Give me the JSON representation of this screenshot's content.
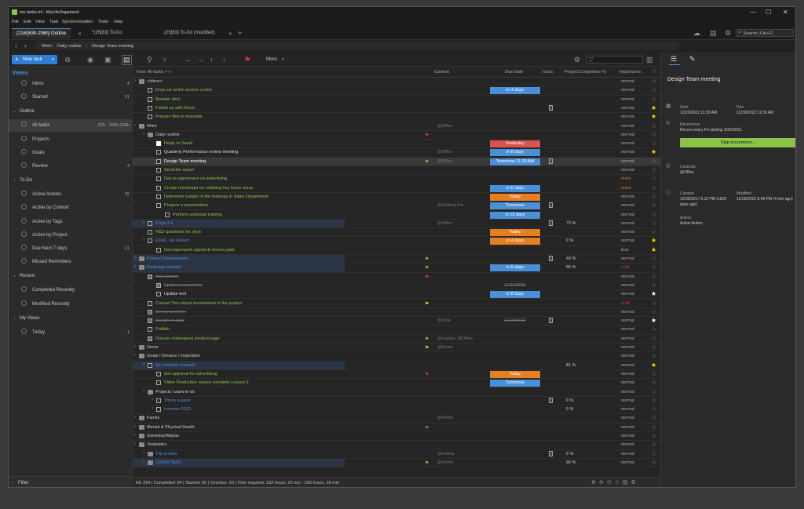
{
  "window": {
    "title": "my tasks.ml - MyLifeOrganized",
    "controls": [
      "—",
      "☐",
      "✕"
    ]
  },
  "menu": [
    "File",
    "Edit",
    "View",
    "Task",
    "Synchronization",
    "Tools",
    "Help"
  ],
  "tabs": [
    {
      "label": "(216/[63h-206h] Outline",
      "active": true
    },
    {
      "label": "*(25[63] To-Do",
      "active": false
    },
    {
      "label": "(25[63] To-Do (modified)",
      "active": false
    }
  ],
  "search": {
    "placeholder": "Search (Ctrl+F)"
  },
  "breadcrumb": [
    "Work",
    "Daily routine",
    "Design Team meeting"
  ],
  "toolbar": {
    "new_task": "New task",
    "more": "More"
  },
  "sidebar": {
    "views_title": "Views",
    "top": [
      {
        "label": "Inbox",
        "count": "4"
      },
      {
        "label": "Starred",
        "count": "31"
      }
    ],
    "outline_title": "Outline",
    "outline": [
      {
        "label": "All tasks",
        "count": "225 · 163h-206h",
        "selected": true
      },
      {
        "label": "Projects",
        "count": ""
      },
      {
        "label": "Goals",
        "count": ""
      },
      {
        "label": "Review",
        "count": "4"
      }
    ],
    "todo_title": "To-Do",
    "todo": [
      {
        "label": "Active Actions",
        "count": "32"
      },
      {
        "label": "Active by Context",
        "count": ""
      },
      {
        "label": "Active by Tags",
        "count": ""
      },
      {
        "label": "Active by Project",
        "count": ""
      },
      {
        "label": "Due Next 7 days",
        "count": "21"
      },
      {
        "label": "Missed Reminders",
        "count": ""
      }
    ],
    "recent_title": "Recent",
    "recent": [
      {
        "label": "Completed Recently",
        "count": ""
      },
      {
        "label": "Modified Recently",
        "count": ""
      }
    ],
    "myviews_title": "My Views",
    "myviews": [
      {
        "label": "Today",
        "count": "1"
      }
    ],
    "filter": "Filter"
  },
  "grid": {
    "headers": {
      "name": "View: All tasks > >",
      "context": "Context",
      "due": "Due Date",
      "icons": "Icons",
      "pct": "Project Completion %",
      "imp": "Importance"
    },
    "rows": [
      {
        "indent": 0,
        "type": "folder",
        "text": "<Inbox>",
        "color": "#ccc"
      },
      {
        "indent": 1,
        "type": "cb",
        "text": "Drop car at the service centre",
        "color": "#8bc34a",
        "due": "in 4 days",
        "dc": "#4a90d9"
      },
      {
        "indent": 1,
        "type": "cb",
        "text": "Booster shot",
        "color": "#8bc34a"
      },
      {
        "indent": 1,
        "type": "cb",
        "text": "Follow up with Kevin",
        "color": "#8bc34a",
        "doc": true,
        "star": "on"
      },
      {
        "indent": 1,
        "type": "cb",
        "text": "Prepare files to translate",
        "color": "#8bc34a",
        "star": "on"
      },
      {
        "indent": 0,
        "type": "folder",
        "text": "Work",
        "color": "#ccc",
        "ctx": "@Office"
      },
      {
        "indent": 1,
        "type": "folder",
        "text": "Daily routine",
        "color": "#ccc",
        "flag": "#e53935"
      },
      {
        "indent": 2,
        "type": "cbw",
        "text": "Reply to Sarah",
        "color": "#8bc34a",
        "due": "Yesterday",
        "dc": "#d9534f"
      },
      {
        "indent": 2,
        "type": "cb",
        "text": "Quarterly Performance review meeting",
        "color": "#ddd",
        "ctx": "@Office",
        "due": "in 8 days",
        "dc": "#4a90d9",
        "star": "on"
      },
      {
        "indent": 2,
        "type": "cb",
        "text": "Design Team meeting",
        "color": "#fff",
        "ctx": "@Office",
        "due": "Tomorrow 11:30 AM",
        "dc": "#4a90d9",
        "doc": true,
        "sel": true,
        "flag": "#8bc34a"
      },
      {
        "indent": 2,
        "type": "cb",
        "text": "Send the report",
        "color": "#8bc34a"
      },
      {
        "indent": 2,
        "type": "cb",
        "text": "Get an agreement on advertising",
        "color": "#8bc34a",
        "imp": "more",
        "ic": "#e67e22"
      },
      {
        "indent": 2,
        "type": "cb",
        "text": "Create mindmaps for outlining key focus areas",
        "color": "#8bc34a",
        "due": "in 6 days",
        "dc": "#4a90d9",
        "imp": "more",
        "ic": "#e67e22"
      },
      {
        "indent": 2,
        "type": "cb",
        "text": "Determine budget of the trainings in Sales Department",
        "color": "#8bc34a",
        "due": "Today",
        "dc": "#e67e22"
      },
      {
        "indent": 2,
        "type": "cb",
        "text": "Prepare a presentation",
        "color": "#8bc34a",
        "ctx": "@Waiting For",
        "due": "Tomorrow",
        "dc": "#4a90d9",
        "doc": true
      },
      {
        "indent": 3,
        "type": "cb",
        "text": "Perform seasonal training",
        "color": "#8bc34a",
        "due": "in 13 days",
        "dc": "#4a90d9"
      },
      {
        "indent": 1,
        "type": "cbp",
        "text": "Project X",
        "color": "#4a90d9",
        "ctx": "@Office",
        "doc": true,
        "pct": "72 %",
        "hl": true
      },
      {
        "indent": 1,
        "type": "cb",
        "text": "R&D questions for Jerry",
        "color": "#8bc34a",
        "due": "Today",
        "dc": "#e67e22"
      },
      {
        "indent": 1,
        "type": "cbp",
        "text": "EDAC Tax Return",
        "color": "#4a90d9",
        "due": "in 4 days",
        "dc": "#e67e22",
        "pct": "0 %",
        "star": "on"
      },
      {
        "indent": 2,
        "type": "cb",
        "text": "Get paperwork signed & invoice paid",
        "color": "#8bc34a",
        "imp": "less",
        "ic": "#8bc34a",
        "star": "on"
      },
      {
        "indent": 0,
        "type": "folderp",
        "text": "Product Development",
        "color": "#4a90d9",
        "flag": "#8bc34a",
        "doc": true,
        "pct": "43 %",
        "hl": true
      },
      {
        "indent": 0,
        "type": "folderp",
        "text": "Redesign website",
        "color": "#4a90d9",
        "flag": "#8bc34a",
        "due": "in 6 days",
        "dc": "#4a90d9",
        "pct": "56 %",
        "imp": "a lot",
        "ic": "#e53935",
        "hl": true
      },
      {
        "indent": 1,
        "type": "cbd",
        "text": "Add content",
        "color": "#777",
        "flag": "#e53935"
      },
      {
        "indent": 2,
        "type": "cbd",
        "text": "Update screenshots",
        "color": "#777",
        "due": "17/12/2022",
        "dc": "none"
      },
      {
        "indent": 2,
        "type": "cb",
        "text": "Update text",
        "color": "#ddd",
        "due": "in 8 days",
        "dc": "#4a90d9",
        "star": "white"
      },
      {
        "indent": 1,
        "type": "cb",
        "text": "Contact Tom about involvement in the project",
        "color": "#8bc34a",
        "flag": "#fdd835",
        "imp": "a lot",
        "ic": "#e53935"
      },
      {
        "indent": 1,
        "type": "cbd",
        "text": "Set up analytics",
        "color": "#777"
      },
      {
        "indent": 1,
        "type": "cbd",
        "text": "Decide on logo",
        "color": "#777",
        "ctx": "@Cafe",
        "due": "12/20/2022",
        "dc": "none",
        "doc": true,
        "star": "white"
      },
      {
        "indent": 1,
        "type": "cb",
        "text": "Publish",
        "color": "#8bc34a"
      },
      {
        "indent": 1,
        "type": "cbd",
        "text": "Discuss redesigned product page",
        "color": "#8bc34a",
        "flag": "#8bc34a",
        "ctx": "@Laptop, @Office"
      },
      {
        "indent": 0,
        "type": "folder",
        "text": "Home",
        "color": "#ccc",
        "flag": "#fdd835",
        "ctx": "@Home"
      },
      {
        "indent": 0,
        "type": "folder",
        "text": "Goals / Dreams / Inspiration",
        "color": "#ccc"
      },
      {
        "indent": 1,
        "type": "cbp",
        "text": "My Youtube channel",
        "color": "#4a90d9",
        "pct": "81 %",
        "star": "on",
        "hl": true
      },
      {
        "indent": 2,
        "type": "cb",
        "text": "Get approval for advertising",
        "color": "#8bc34a",
        "flag": "#e53935",
        "due": "Today",
        "dc": "#e67e22"
      },
      {
        "indent": 2,
        "type": "cb",
        "text": "Video Production course complete Lesson 3",
        "color": "#8bc34a",
        "due": "Tomorrow",
        "dc": "#4a90d9"
      },
      {
        "indent": 1,
        "type": "folder",
        "text": "Projects I want to-do",
        "color": "#ccc"
      },
      {
        "indent": 2,
        "type": "cbp",
        "text": "Throw a party",
        "color": "#4a90d9",
        "doc": true,
        "pct": "0 %"
      },
      {
        "indent": 2,
        "type": "cbp",
        "text": "Ironman 2023",
        "color": "#4a90d9",
        "pct": "0 %"
      },
      {
        "indent": 0,
        "type": "folder",
        "text": "Family",
        "color": "#ccc",
        "ctx": "@Home"
      },
      {
        "indent": 0,
        "type": "folder",
        "text": "Mental & Physical Health",
        "color": "#ccc",
        "flag": "#4a90d9"
      },
      {
        "indent": 0,
        "type": "folder",
        "text": "Someday/Maybe",
        "color": "#ccc"
      },
      {
        "indent": 0,
        "type": "folder",
        "text": "Templates",
        "color": "#ccc"
      },
      {
        "indent": 1,
        "type": "folderp",
        "text": "Trip to Asia",
        "color": "#4a90d9",
        "ctx": "@Family",
        "doc": true,
        "pct": "0 %"
      },
      {
        "indent": 1,
        "type": "folderp",
        "text": "CHRISTMAS",
        "color": "#4a90d9",
        "flag": "#8bc34a",
        "ctx": "@Home",
        "pct": "90 %",
        "hl": true
      }
    ]
  },
  "status": {
    "text": "All: 254 | Completed: 94 | Started: 26 | Overdue: 20 | Time required: 163 hours, 20 min - 206 hours, 16 min"
  },
  "detail": {
    "title": "Design Team meeting",
    "start_label": "Start",
    "start": "12/29/2022 11:30 AM",
    "due_label": "Due",
    "due": "12/30/2022 11:30 AM",
    "recurrence_label": "Recurrence",
    "recurrence": "Recurs every Fri starting 3/30/2019.",
    "skip": "Skip occurrence...",
    "contexts_label": "Contexts",
    "contexts": "@Office",
    "created_label": "Created",
    "created": "12/30/2017 6:12 PM (1829 days ago)",
    "modified_label": "Modified",
    "modified": "12/26/2022 8:48 PM (4 min ago)",
    "action_label": "Action",
    "action": "Active Action"
  }
}
